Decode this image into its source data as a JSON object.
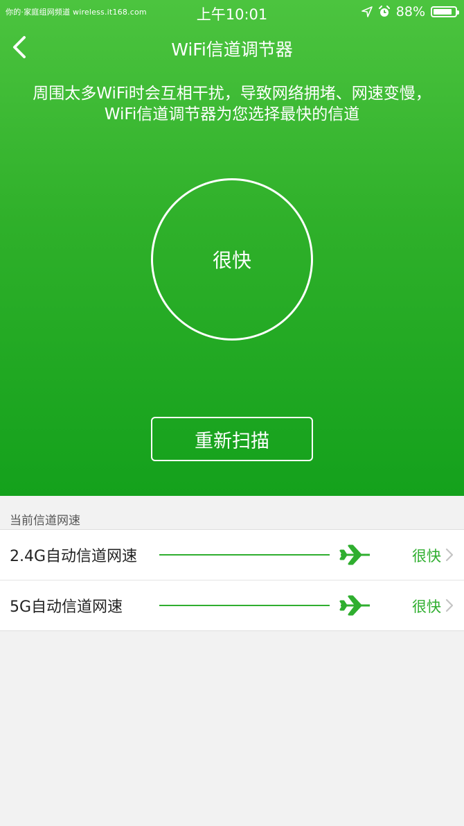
{
  "watermark": "你的·家庭组网频道 wireless.it168.com",
  "status_bar": {
    "time": "上午10:01",
    "battery": "88%",
    "battery_level": 0.88
  },
  "nav": {
    "title": "WiFi信道调节器"
  },
  "description": "周围太多WiFi时会互相干扰，导致网络拥堵、网速变慢，WiFi信道调节器为您选择最快的信道",
  "speed_status": "很快",
  "rescan_label": "重新扫描",
  "section_label": "当前信道网速",
  "rows": [
    {
      "name": "2.4G自动信道网速",
      "status": "很快"
    },
    {
      "name": "5G自动信道网速",
      "status": "很快"
    }
  ],
  "colors": {
    "accent": "#2fae2f",
    "hero_top": "#4cc43f",
    "hero_bottom": "#14a11c"
  }
}
